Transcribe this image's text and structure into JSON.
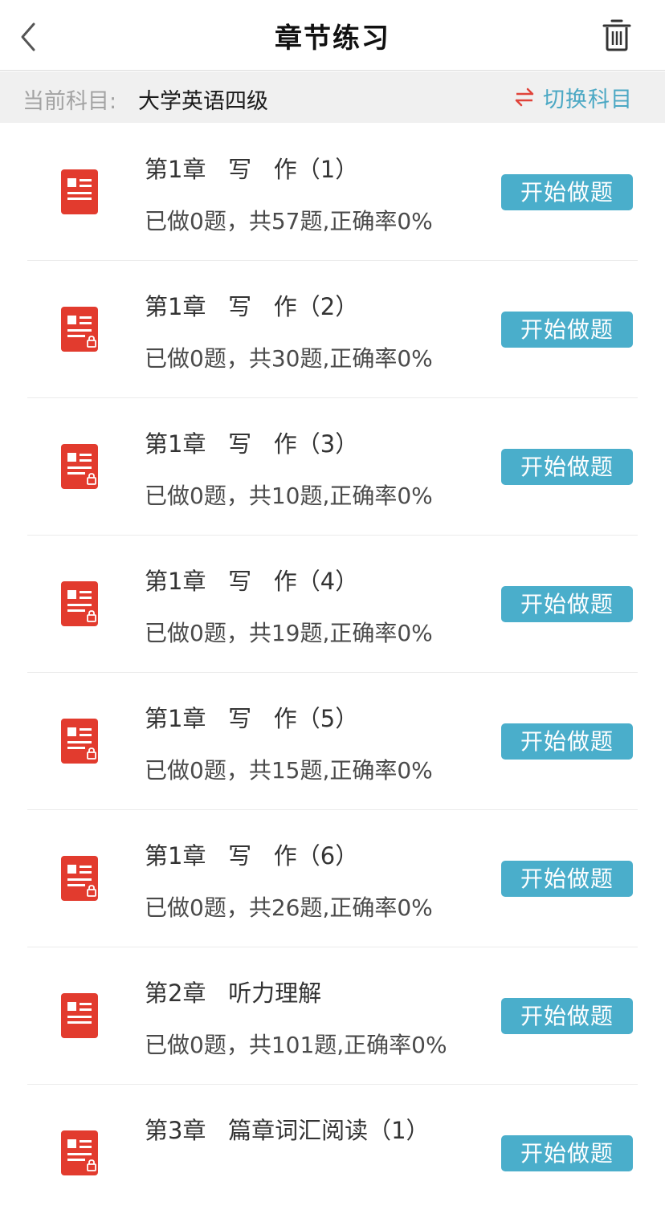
{
  "header": {
    "title": "章节练习"
  },
  "subject_bar": {
    "label": "当前科目:",
    "value": "大学英语四级",
    "switch_label": "切换科目",
    "switch_icon_color": "#e0433a",
    "switch_text_color": "#4ba8c4"
  },
  "colors": {
    "accent": "#4aaecb",
    "icon_red": "#e23b2e"
  },
  "chapters": [
    {
      "title": "第1章   写   作（1）",
      "stats": "已做0题，共57题,正确率0%",
      "button": "开始做题",
      "icon": "document-icon",
      "locked": false
    },
    {
      "title": "第1章   写   作（2）",
      "stats": "已做0题，共30题,正确率0%",
      "button": "开始做题",
      "icon": "document-lock-icon",
      "locked": true
    },
    {
      "title": "第1章   写   作（3）",
      "stats": "已做0题，共10题,正确率0%",
      "button": "开始做题",
      "icon": "document-lock-icon",
      "locked": true
    },
    {
      "title": "第1章   写   作（4）",
      "stats": "已做0题，共19题,正确率0%",
      "button": "开始做题",
      "icon": "document-lock-icon",
      "locked": true
    },
    {
      "title": "第1章   写   作（5）",
      "stats": "已做0题，共15题,正确率0%",
      "button": "开始做题",
      "icon": "document-lock-icon",
      "locked": true
    },
    {
      "title": "第1章   写   作（6）",
      "stats": "已做0题，共26题,正确率0%",
      "button": "开始做题",
      "icon": "document-lock-icon",
      "locked": true
    },
    {
      "title": "第2章   听力理解",
      "stats": "已做0题，共101题,正确率0%",
      "button": "开始做题",
      "icon": "document-icon",
      "locked": false
    },
    {
      "title": "第3章   篇章词汇阅读（1）",
      "stats": "",
      "button": "开始做题",
      "icon": "document-lock-icon",
      "locked": true
    }
  ]
}
